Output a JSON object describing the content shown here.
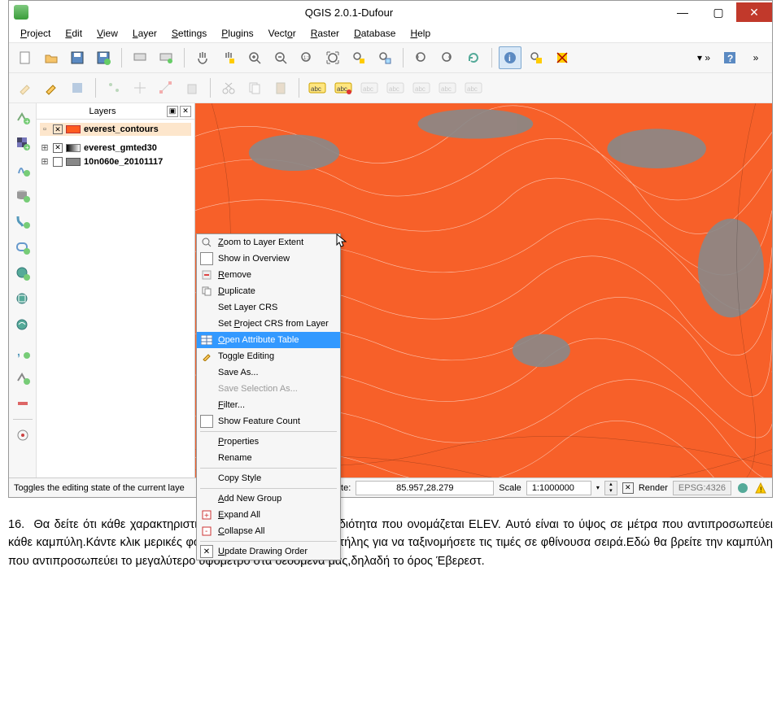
{
  "window": {
    "title": "QGIS 2.0.1-Dufour"
  },
  "menu": [
    "Project",
    "Edit",
    "View",
    "Layer",
    "Settings",
    "Plugins",
    "Vector",
    "Raster",
    "Database",
    "Help"
  ],
  "menu_keys": [
    "P",
    "E",
    "V",
    "L",
    "S",
    "P",
    "V",
    "R",
    "D",
    "H"
  ],
  "layers_panel": {
    "title": "Layers",
    "items": [
      {
        "name": "everest_contours",
        "checked": true,
        "selected": true,
        "swatch": "sw-orange",
        "expanded": false
      },
      {
        "name": "everest_gmted30",
        "checked": true,
        "selected": false,
        "swatch": "sw-grad",
        "expanded": true
      },
      {
        "name": "10n060e_20101117",
        "checked": false,
        "selected": false,
        "swatch": "sw-gray",
        "expanded": true
      }
    ]
  },
  "context_menu": [
    {
      "label": "Zoom to Layer Extent",
      "icon": "zoom",
      "u": "Z"
    },
    {
      "label": "Show in Overview",
      "icon": "chkbox",
      "u": ""
    },
    {
      "label": "Remove",
      "icon": "remove",
      "u": "R"
    },
    {
      "label": "Duplicate",
      "icon": "dup",
      "u": "D"
    },
    {
      "label": "Set Layer CRS",
      "icon": "",
      "u": ""
    },
    {
      "label": "Set Project CRS from Layer",
      "icon": "",
      "u": "P"
    },
    {
      "label": "Open Attribute Table",
      "icon": "table",
      "u": "O",
      "selected": true
    },
    {
      "label": "Toggle Editing",
      "icon": "pencil",
      "u": ""
    },
    {
      "label": "Save As...",
      "icon": "",
      "u": ""
    },
    {
      "label": "Save Selection As...",
      "icon": "",
      "u": "",
      "disabled": true
    },
    {
      "label": "Filter...",
      "icon": "",
      "u": "F"
    },
    {
      "label": "Show Feature Count",
      "icon": "chkbox",
      "u": ""
    },
    {
      "label": "Properties",
      "icon": "",
      "u": "P"
    },
    {
      "label": "Rename",
      "icon": "",
      "u": ""
    },
    {
      "label": "Copy Style",
      "icon": "",
      "u": ""
    },
    {
      "label": "Add New Group",
      "icon": "",
      "u": "A"
    },
    {
      "label": "Expand All",
      "icon": "expand",
      "u": "E"
    },
    {
      "label": "Collapse All",
      "icon": "collapse",
      "u": "C"
    },
    {
      "label": "Update Drawing Order",
      "icon": "chkx",
      "u": "U"
    }
  ],
  "status": {
    "hint": "Toggles the editing state of the current laye",
    "coord_label": "Coordinate:",
    "coord_value": "85.957,28.279",
    "scale_label": "Scale",
    "scale_value": "1:1000000",
    "render_label": "Render",
    "crs": "EPSG:4326"
  },
  "footer": {
    "num": "16.",
    "text": "Θα δείτε ότι κάθε χαρακτηριστικό της καμπύλης έχει μια ιδιότητα που ονομάζεται ELEV. Αυτό είναι το ύψος σε μέτρα που αντιπροσωπεύει κάθε καμπύλη.Κάντε κλικ μερικές φορές στο πάνω μέρος της στήλης για να ταξινομήσετε τις τιμές σε φθίνουσα σειρά.Εδώ θα βρείτε την καμπύλη που αντιπροσωπεύει το μεγαλύτερο υψόμετρο στα δεδομένα μας,δηλαδή το όρος Έβερεστ."
  }
}
